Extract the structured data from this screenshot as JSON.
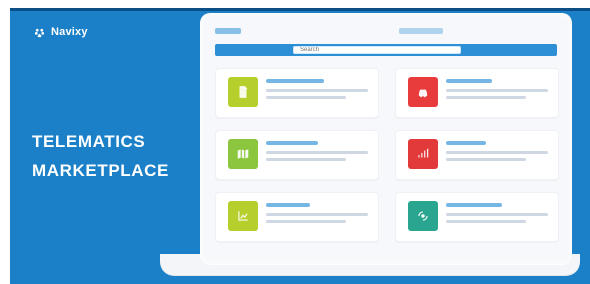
{
  "brand": {
    "label": "Navixy",
    "icon": "paw-icon"
  },
  "headline": {
    "line1": "TELEMATICS",
    "line2": "MARKETPLACE"
  },
  "search": {
    "placeholder": "Search"
  },
  "cards": [
    {
      "tile_color": "#b7cf2c",
      "icon": "document-icon"
    },
    {
      "tile_color": "#e83b3b",
      "icon": "car-icon"
    },
    {
      "tile_color": "#8cc63f",
      "icon": "map-icon"
    },
    {
      "tile_color": "#e23a3a",
      "icon": "signal-icon"
    },
    {
      "tile_color": "#b7cf2c",
      "icon": "chart-icon"
    },
    {
      "tile_color": "#2aa58f",
      "icon": "sensor-icon"
    }
  ],
  "colors": {
    "background_blue": "#1b80c7",
    "header_blue": "#2d8fd6"
  }
}
